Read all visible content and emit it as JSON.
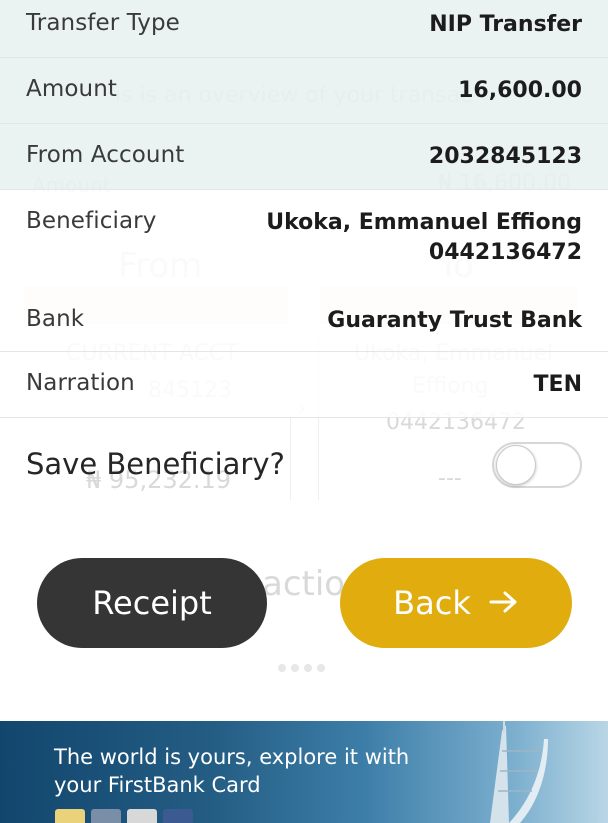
{
  "details": {
    "transfer_type": {
      "label": "Transfer Type",
      "value": "NIP Transfer"
    },
    "amount": {
      "label": "Amount",
      "value": "16,600.00"
    },
    "from_account": {
      "label": "From Account",
      "value": "2032845123"
    },
    "beneficiary": {
      "label": "Beneficiary",
      "name": "Ukoka, Emmanuel Effiong",
      "account": "0442136472"
    },
    "bank": {
      "label": "Bank",
      "value": "Guaranty Trust Bank"
    },
    "narration": {
      "label": "Narration",
      "value": "TEN"
    }
  },
  "save_beneficiary": {
    "label": "Save Beneficiary?",
    "enabled": false
  },
  "buttons": {
    "receipt": "Receipt",
    "back": "Back"
  },
  "banner": {
    "line1": "The world is yours, explore it with",
    "line2": "your FirstBank Card"
  },
  "colors": {
    "back_button": "#e1ac0e",
    "receipt_button": "#353535",
    "tinted_row": "#e8f0f0"
  },
  "icons": {
    "back_arrow": "arrow-right-icon"
  }
}
